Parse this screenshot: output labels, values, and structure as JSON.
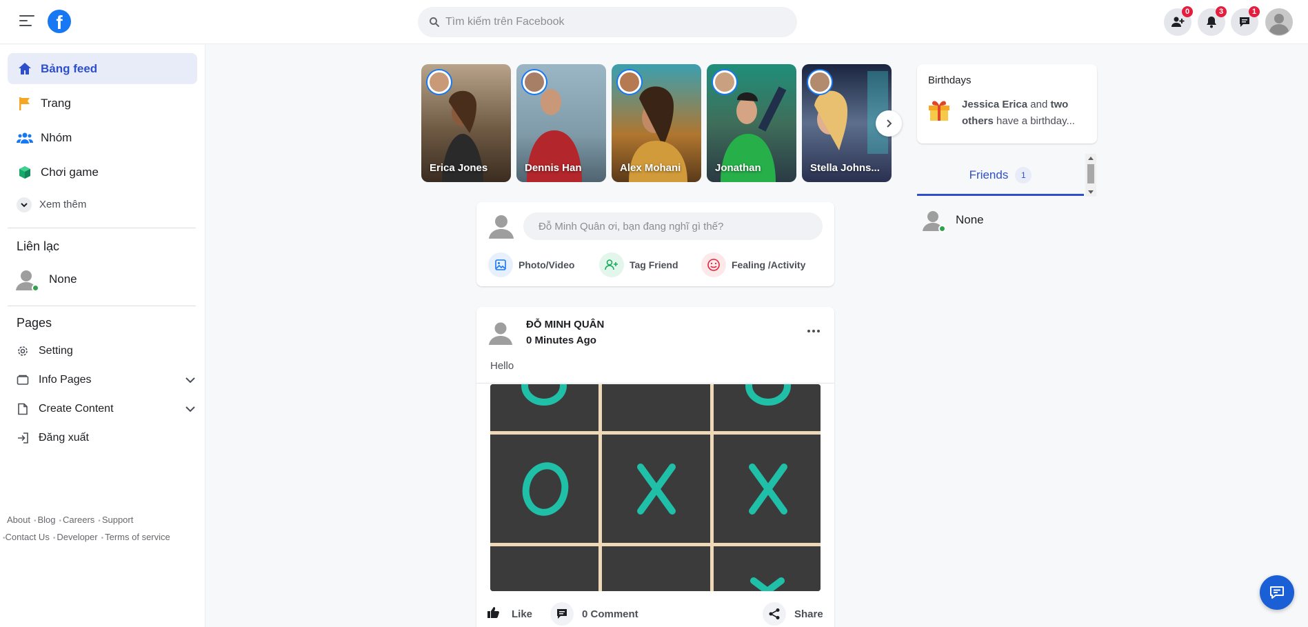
{
  "header": {
    "logo": "f",
    "search_placeholder": "Tìm kiếm trên Facebook",
    "friend_requests_count": "0",
    "notifications_count": "3",
    "messages_count": "1"
  },
  "sidebar": {
    "nav": [
      {
        "label": "Bảng feed",
        "icon": "home-icon"
      },
      {
        "label": "Trang",
        "icon": "flag-icon"
      },
      {
        "label": "Nhóm",
        "icon": "groups-icon"
      },
      {
        "label": "Chơi game",
        "icon": "game-cube-icon"
      }
    ],
    "see_more": "Xem thêm",
    "contacts_title": "Liên lạc",
    "contact_name": "None",
    "pages_title": "Pages",
    "pages": [
      {
        "label": "Setting",
        "icon": "gear-icon"
      },
      {
        "label": "Info Pages",
        "icon": "folder-icon"
      },
      {
        "label": "Create Content",
        "icon": "document-icon"
      },
      {
        "label": "Đăng xuất",
        "icon": "logout-icon"
      }
    ],
    "footer": {
      "about": "About",
      "blog": "Blog",
      "careers": "Careers",
      "support": "Support",
      "contact": "Contact Us",
      "developer": "Developer",
      "terms": "Terms of service"
    }
  },
  "stories": [
    {
      "name": "Erica Jones",
      "bg": "#8a7560"
    },
    {
      "name": "Dennis Han",
      "bg": "#7f9aa8"
    },
    {
      "name": "Alex Mohani",
      "bg": "#b0762f"
    },
    {
      "name": "Jonathan",
      "bg": "#3f6e5a"
    },
    {
      "name": "Stella Johns...",
      "bg": "#5c6f8c"
    }
  ],
  "composer": {
    "placeholder": "Đỗ Minh Quân ơi, bạn đang nghĩ gì thế?",
    "photo_label": "Photo/Video",
    "tag_label": "Tag Friend",
    "feeling_label": "Fealing /Activity"
  },
  "post": {
    "author": "ĐỖ MINH QUÂN",
    "time": "0 Minutes Ago",
    "text": "Hello",
    "like_label": "Like",
    "comment_label": "0 Comment",
    "share_label": "Share"
  },
  "birthdays": {
    "title": "Birthdays",
    "name": "Jessica Erica",
    "and": " and ",
    "others": "two others",
    "suffix": " have a birthday..."
  },
  "friends": {
    "tab_label": "Friends",
    "count": "1",
    "friend_name": "None"
  },
  "colors": {
    "accent": "#2e4fcc",
    "brand": "#1877f2",
    "online": "#31a24c",
    "badge": "#e41e3f",
    "game_mark": "#1fbfa8"
  }
}
